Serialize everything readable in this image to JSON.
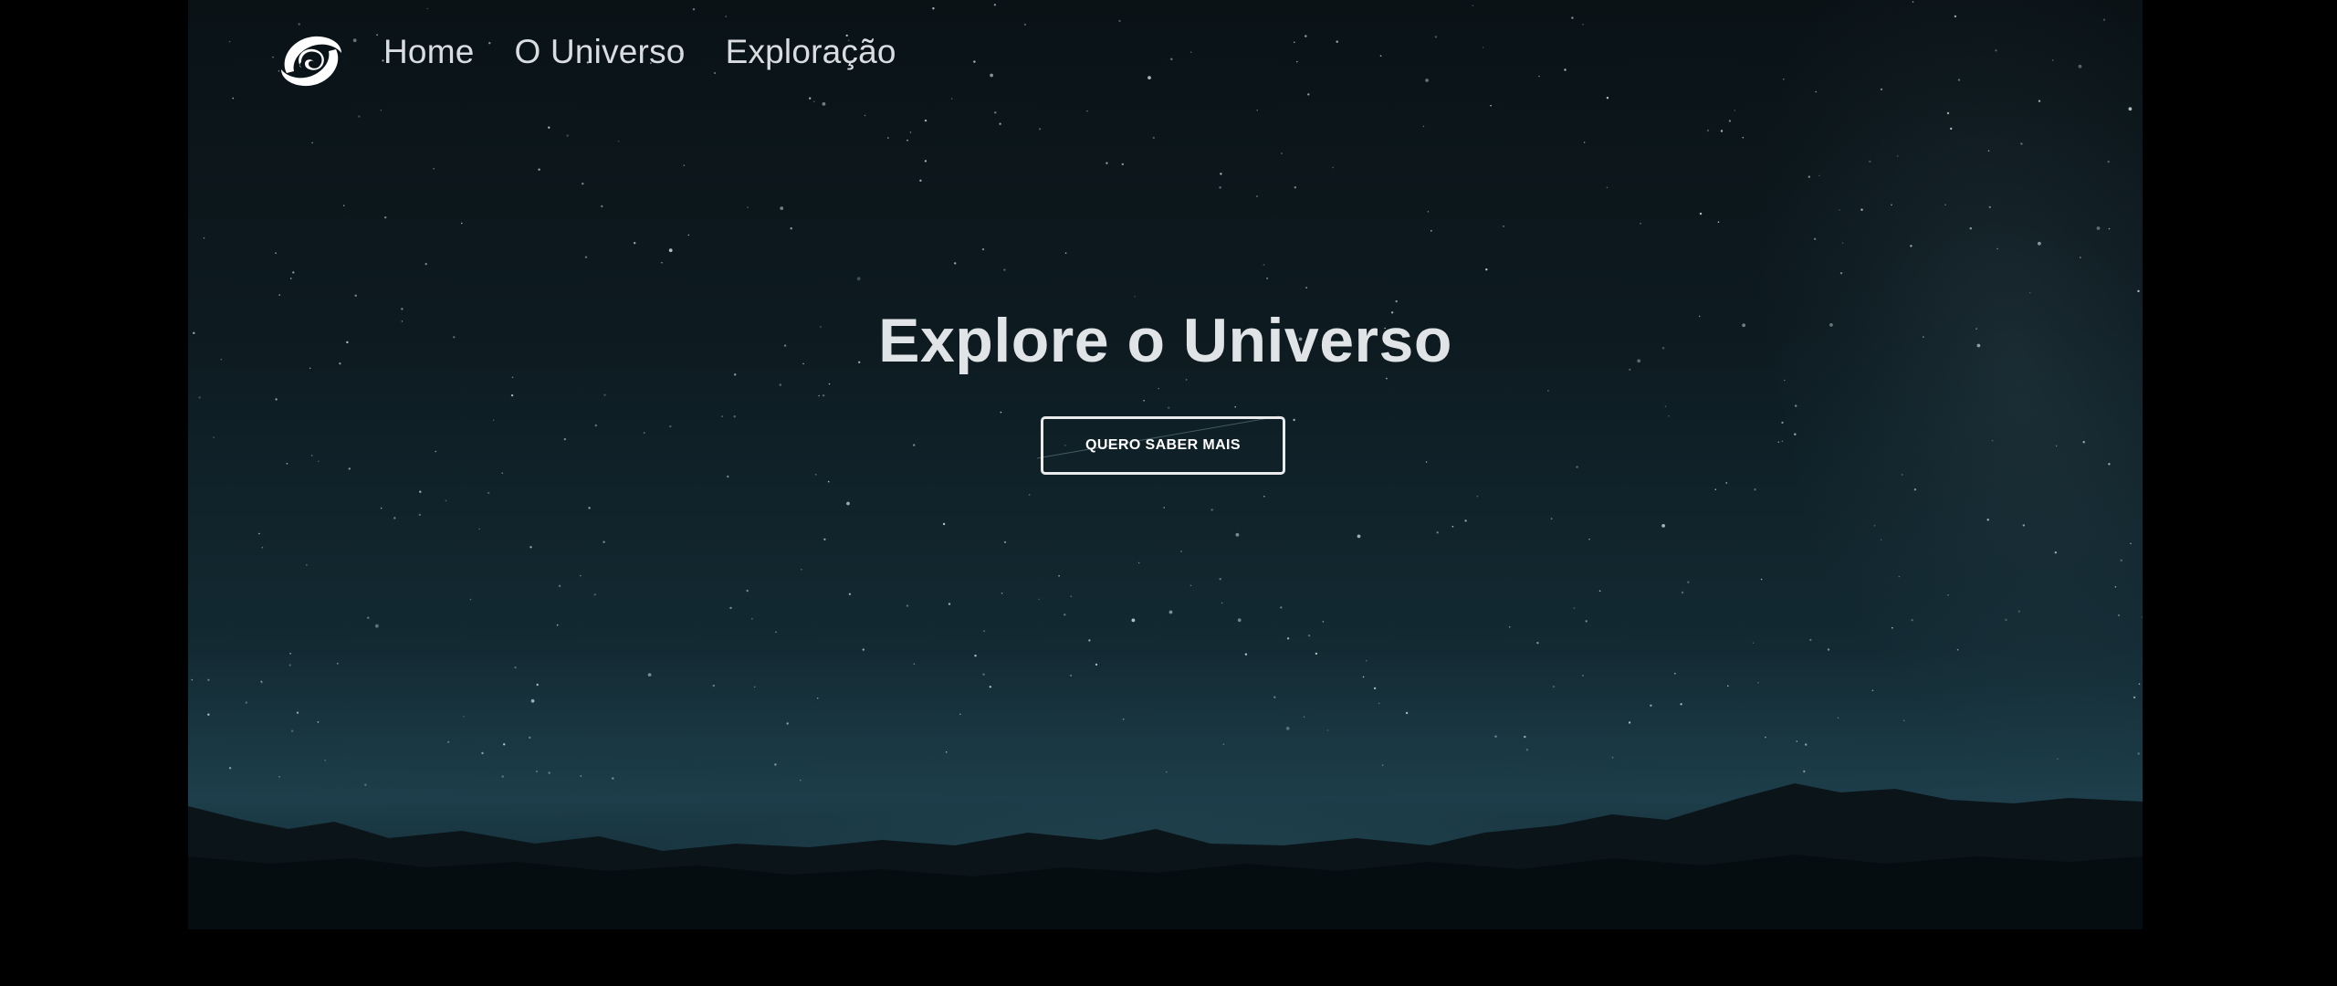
{
  "nav": {
    "logo_icon": "spiral-galaxy-icon",
    "links": [
      {
        "label": "Home"
      },
      {
        "label": "O Universo"
      },
      {
        "label": "Exploração"
      }
    ]
  },
  "hero": {
    "title": "Explore o Universo",
    "cta_label": "QUERO SABER MAIS"
  },
  "colors": {
    "page_background": "#000000",
    "sky_top": "#0a1216",
    "sky_horizon": "#1d3f4b",
    "text": "#e1e4e7",
    "button_border": "#e8eaec"
  }
}
